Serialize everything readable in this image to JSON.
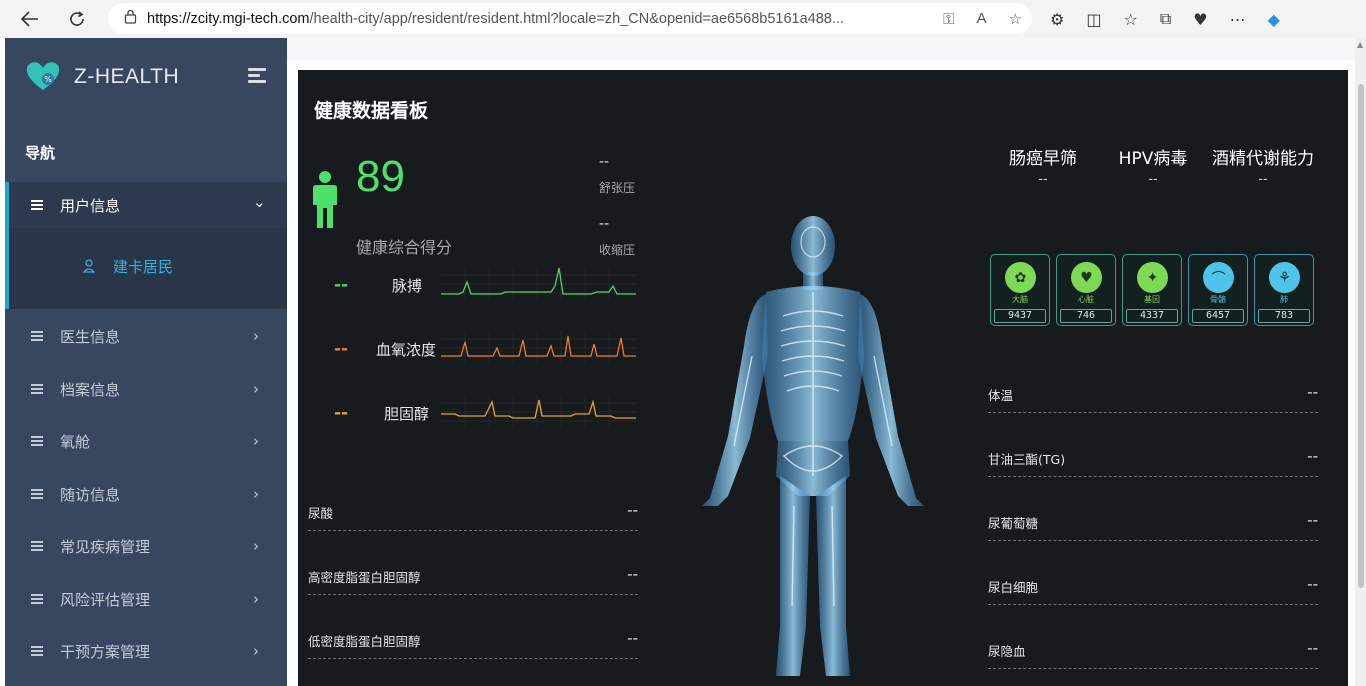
{
  "browser": {
    "url_host": "https://zcity.mgi-tech.com",
    "url_path": "/health-city/app/resident/resident.html?locale=zh_CN&openid=ae6568b5161a488..."
  },
  "sidebar": {
    "brand": "Z-HEALTH",
    "nav_title": "导航",
    "open_menu": {
      "label": "用户信息",
      "sub_item": "建卡居民"
    },
    "items": [
      {
        "label": "医生信息"
      },
      {
        "label": "档案信息"
      },
      {
        "label": "氧舱"
      },
      {
        "label": "随访信息"
      },
      {
        "label": "常见疾病管理"
      },
      {
        "label": "风险评估管理"
      },
      {
        "label": "干预方案管理"
      }
    ]
  },
  "dashboard": {
    "title": "健康数据看板",
    "score": "89",
    "score_label": "健康综合得分",
    "bp": [
      {
        "value": "--",
        "label": "舒张压"
      },
      {
        "value": "--",
        "label": "收缩压"
      }
    ],
    "vitals": [
      {
        "value": "--",
        "label": "脉搏",
        "color": "#4ed36b"
      },
      {
        "value": "--",
        "label": "血氧浓度",
        "color": "#f07a2f"
      },
      {
        "value": "--",
        "label": "胆固醇",
        "color": "#e2a62a"
      }
    ],
    "left_labs": [
      {
        "name": "尿酸",
        "value": "--"
      },
      {
        "name": "高密度脂蛋白胆固醇",
        "value": "--"
      },
      {
        "name": "低密度脂蛋白胆固醇",
        "value": "--"
      }
    ],
    "screenings": [
      {
        "title": "肠癌早筛",
        "value": "--"
      },
      {
        "title": "HPV病毒",
        "value": "--"
      },
      {
        "title": "酒精代谢能力",
        "value": "--"
      }
    ],
    "organs": [
      {
        "name": "大脑",
        "count": "9437",
        "color": "#7ed957",
        "icon": "brain-icon"
      },
      {
        "name": "心脏",
        "count": "746",
        "color": "#7ed957",
        "icon": "heart-icon"
      },
      {
        "name": "基因",
        "count": "4337",
        "color": "#7ed957",
        "icon": "dna-icon"
      },
      {
        "name": "骨骼",
        "count": "6457",
        "color": "#4fc3e8",
        "icon": "bone-icon"
      },
      {
        "name": "肺",
        "count": "783",
        "color": "#4fc3e8",
        "icon": "lung-icon"
      }
    ],
    "right_labs": [
      {
        "name": "体温",
        "value": "--"
      },
      {
        "name": "甘油三酯(TG)",
        "value": "--"
      },
      {
        "name": "尿葡萄糖",
        "value": "--"
      },
      {
        "name": "尿白细胞",
        "value": "--"
      },
      {
        "name": "尿隐血",
        "value": "--"
      }
    ]
  }
}
